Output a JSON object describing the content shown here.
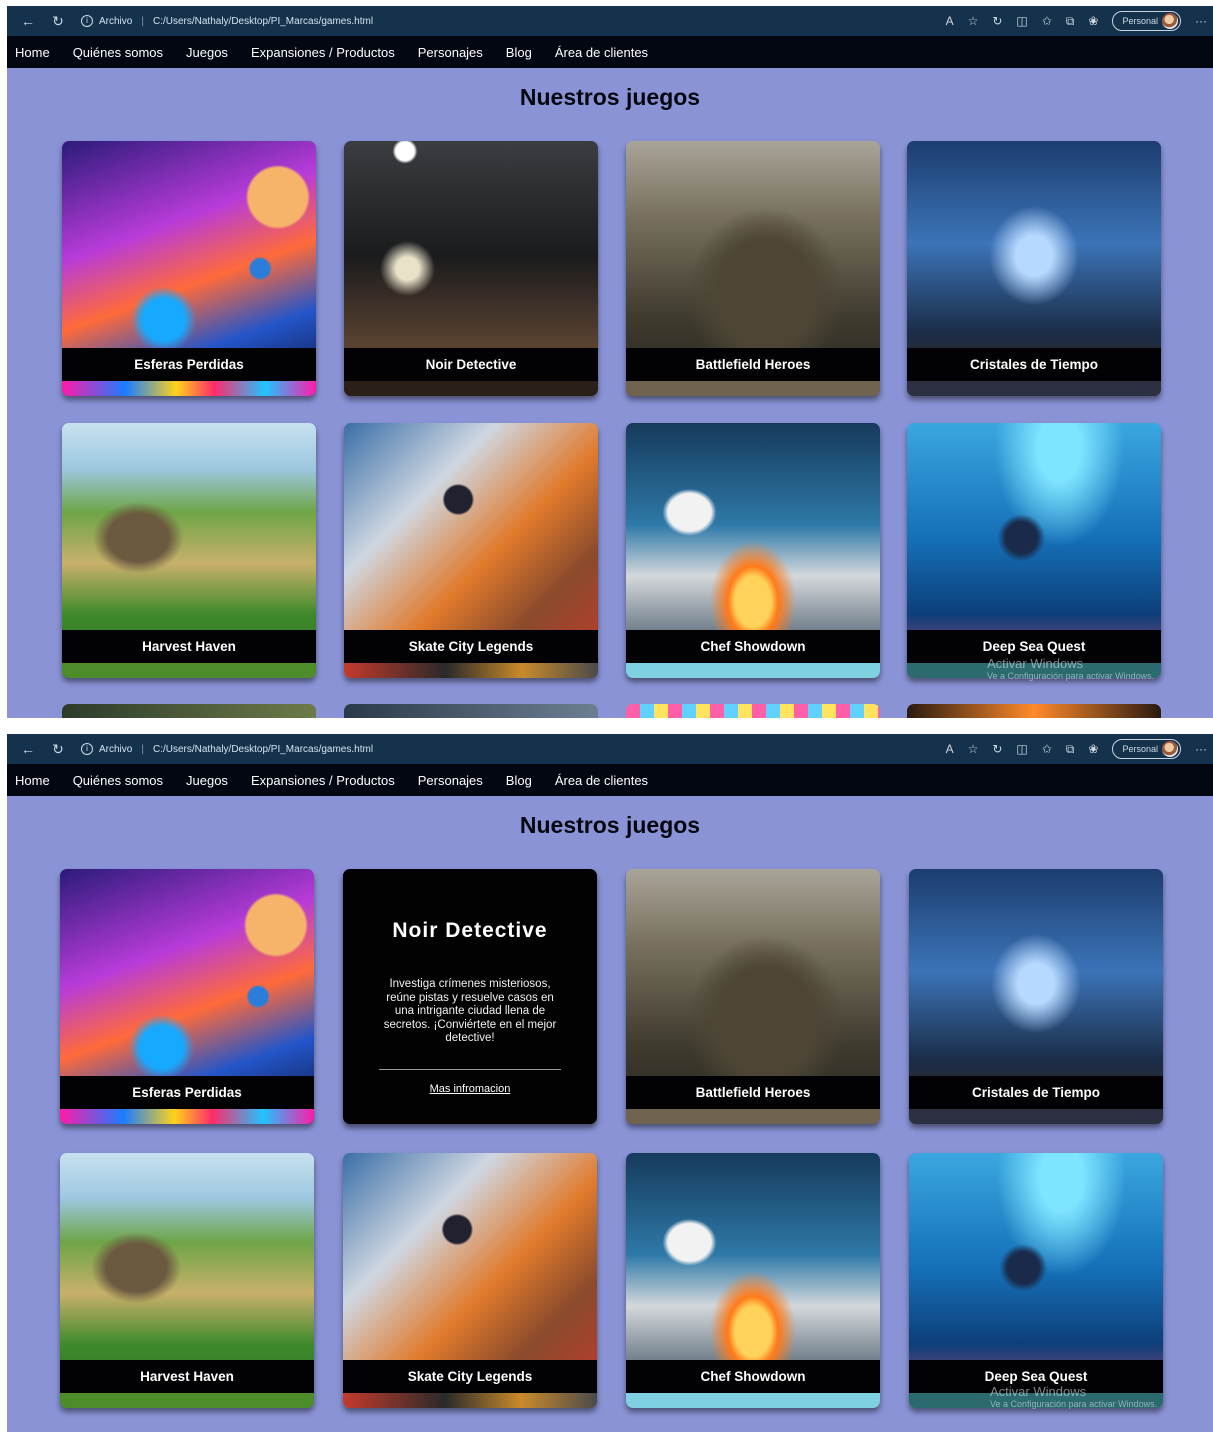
{
  "browser": {
    "file_label": "Archivo",
    "address": "C:/Users/Nathaly/Desktop/PI_Marcas/games.html",
    "profile_label": "Personal"
  },
  "nav": {
    "items": [
      "Home",
      "Quiénes somos",
      "Juegos",
      "Expansiones / Productos",
      "Personajes",
      "Blog",
      "Área de clientes"
    ]
  },
  "page": {
    "title": "Nuestros juegos"
  },
  "games": [
    {
      "title": "Esferas Perdidas"
    },
    {
      "title": "Noir Detective"
    },
    {
      "title": "Battlefield Heroes"
    },
    {
      "title": "Cristales de Tiempo"
    },
    {
      "title": "Harvest Haven"
    },
    {
      "title": "Skate City Legends"
    },
    {
      "title": "Chef Showdown"
    },
    {
      "title": "Deep Sea Quest"
    }
  ],
  "flipped_card": {
    "title": "Noir Detective",
    "description": "Investiga crímenes misteriosos, reúne pistas y resuelve casos en una intrigante ciudad llena de secretos. ¡Conviértete en el mejor detective!",
    "link": "Mas infromacion"
  },
  "watermark": {
    "line1": "Activar Windows",
    "line2": "Ve a Configuración para activar Windows."
  }
}
